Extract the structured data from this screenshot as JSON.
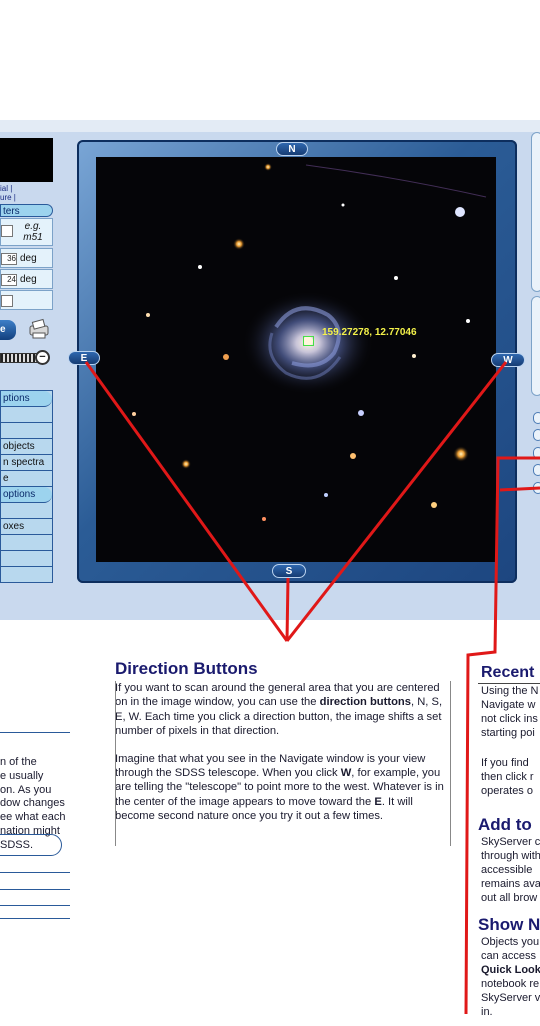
{
  "left_panel": {
    "links": [
      "ial |",
      "ure |"
    ],
    "params_label": "ters",
    "name_example": "e.g. m51",
    "ra_value": "36",
    "ra_unit": "deg",
    "dec_value": "24",
    "dec_unit": "deg",
    "get_label": "e",
    "rows": [
      {
        "label": "ptions",
        "pill": true
      },
      {
        "label": "",
        "pill": false
      },
      {
        "label": "",
        "pill": false
      },
      {
        "label": "objects",
        "pill": false
      },
      {
        "label": "n spectra",
        "pill": false
      },
      {
        "label": "e",
        "pill": false
      },
      {
        "label": "options",
        "pill": true
      },
      {
        "label": "",
        "pill": false
      },
      {
        "label": "oxes",
        "pill": false
      },
      {
        "label": "",
        "pill": false
      },
      {
        "label": "",
        "pill": false
      },
      {
        "label": "",
        "pill": false
      }
    ]
  },
  "navigator": {
    "north": "N",
    "south": "S",
    "east": "E",
    "west": "W",
    "coordinates": "159.27278, 12.77046"
  },
  "help": {
    "title": "Direction Buttons",
    "p1_a": "If you want to scan around the general area that you are centered on in the image window, you can use the ",
    "p1_b": "direction buttons",
    "p1_c": ", N, S, E, W. Each time you click a direction button, the image shifts a set number of pixels in that direction.",
    "p2_a": "Imagine that what you see in the Navigate window is your view through the SDSS telescope.  When you click ",
    "p2_b": "W",
    "p2_c": ", for example, you are telling the \"telescope\" to point more to the west.  Whatever is in the center of the image appears to move toward the ",
    "p2_d": "E",
    "p2_e": ".  It will become second nature once you try it out a few times."
  },
  "left_fragment": [
    "n of the",
    "e usually",
    "on.  As you",
    "dow changes",
    "ee what each",
    "nation might",
    " SDSS."
  ],
  "right_column": {
    "recent_title": "Recent",
    "recent_lines": [
      "Using the N",
      "Navigate w",
      "not click ins",
      "starting poi",
      "",
      " If you find",
      "then click r",
      "operates o"
    ],
    "add_title": "Add to",
    "add_lines": [
      "SkyServer c",
      "through with",
      "accessible",
      "remains ava",
      "out all brow"
    ],
    "show_title": "Show N",
    "show_lines": [
      "Objects you",
      "can access",
      "Quick Look",
      "notebook re",
      "SkyServer v",
      "in."
    ]
  }
}
